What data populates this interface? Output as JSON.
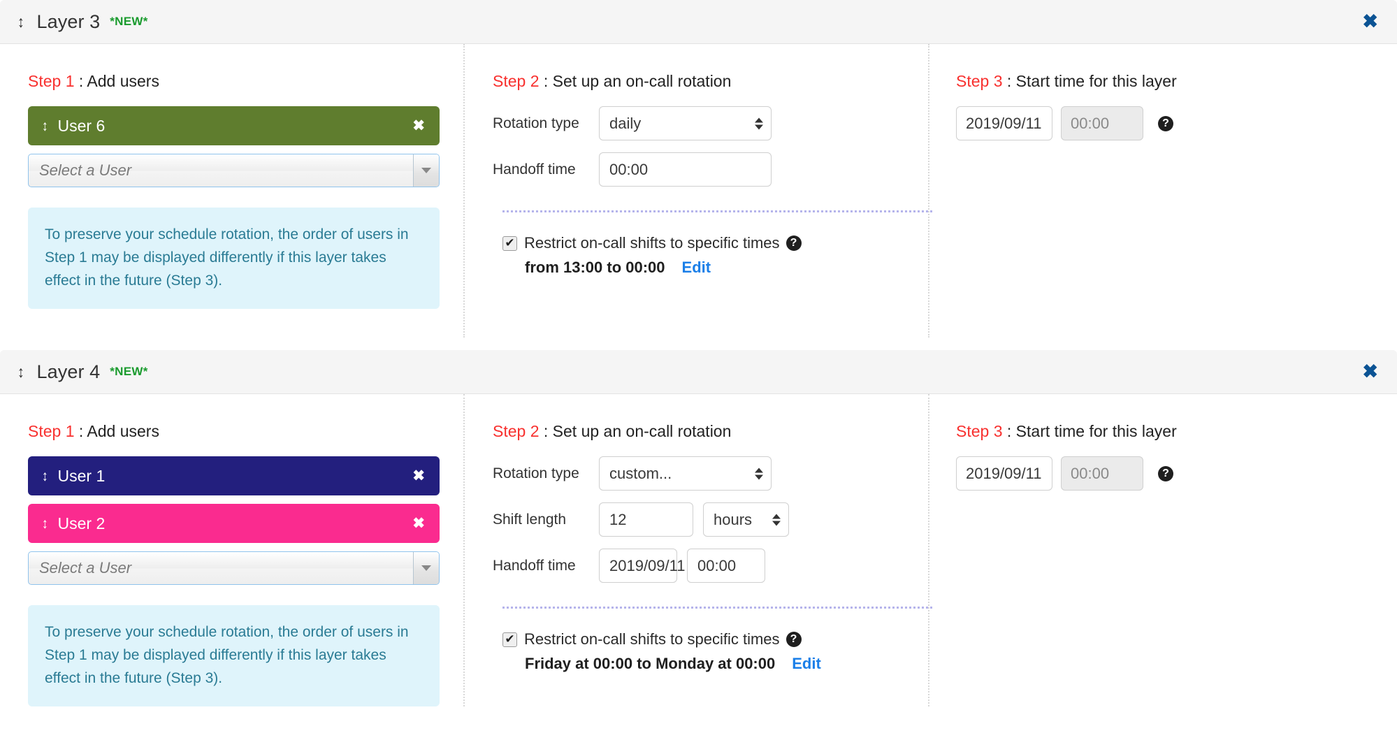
{
  "icons": {
    "drag": "↕",
    "close": "✖",
    "remove": "✖",
    "check": "✔",
    "question": "?"
  },
  "colors": {
    "accent_red": "#f8312f",
    "new_green": "#1a9b2e",
    "close_blue": "#0b5394",
    "link_blue": "#1b7fe8",
    "note_bg": "#dff4fb",
    "note_text": "#2a7b94",
    "user6": "#5f7d2e",
    "user1": "#231f7e",
    "user2": "#fa2b8f"
  },
  "common": {
    "step1_num": "Step 1",
    "step1_sep": " : ",
    "step1_text": "Add users",
    "step2_num": "Step 2",
    "step2_sep": " : ",
    "step2_text": "Set up an on-call rotation",
    "step3_num": "Step 3",
    "step3_sep": " : ",
    "step3_text": "Start time for this layer",
    "select_user_placeholder": "Select a User",
    "note_text": "To preserve your schedule rotation, the order of users in Step 1 may be displayed differently if this layer takes effect in the future (Step 3).",
    "label_rotation_type": "Rotation type",
    "label_handoff_time": "Handoff time",
    "label_shift_length": "Shift length",
    "restrict_label": "Restrict on-call shifts to specific times",
    "edit_label": "Edit"
  },
  "layers": [
    {
      "title": "Layer 3",
      "badge": "*NEW*",
      "users": [
        {
          "name": "User 6",
          "color": "#5f7d2e"
        }
      ],
      "rotation_type": "daily",
      "has_shift_length": false,
      "shift_length_value": "",
      "shift_length_unit": "",
      "handoff_date": "",
      "handoff_time": "00:00",
      "restrict_checked": true,
      "restrict_summary": "from 13:00 to 00:00",
      "start_date": "2019/09/11",
      "start_time": "00:00"
    },
    {
      "title": "Layer 4",
      "badge": "*NEW*",
      "users": [
        {
          "name": "User 1",
          "color": "#231f7e"
        },
        {
          "name": "User 2",
          "color": "#fa2b8f"
        }
      ],
      "rotation_type": "custom...",
      "has_shift_length": true,
      "shift_length_value": "12",
      "shift_length_unit": "hours",
      "handoff_date": "2019/09/11",
      "handoff_time": "00:00",
      "restrict_checked": true,
      "restrict_summary": "Friday at 00:00 to Monday at 00:00",
      "start_date": "2019/09/11",
      "start_time": "00:00"
    }
  ]
}
